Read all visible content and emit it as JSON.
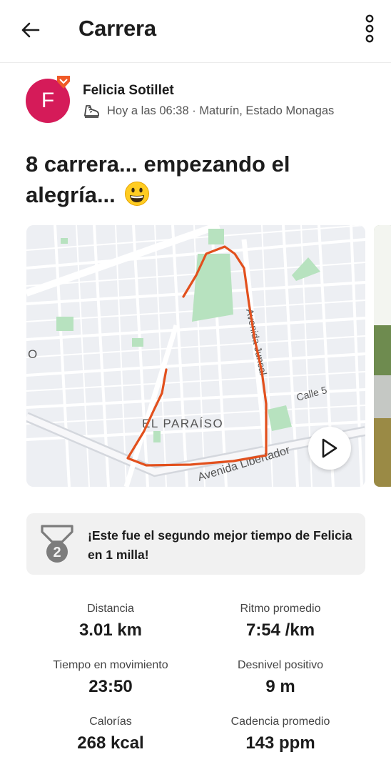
{
  "header": {
    "title": "Carrera",
    "back_icon": "arrow-left-icon",
    "more_icon": "more-vertical-icon"
  },
  "author": {
    "initial": "F",
    "name": "Felicia Sotillet",
    "meta": "Hoy a las 06:38 · Maturín, Estado Monagas",
    "avatar_color": "#d51b59",
    "badge_color": "#f05a28",
    "activity_icon": "shoe-icon"
  },
  "activity": {
    "title": "8 carrera... empezando el alegría...",
    "emoji": "grinning-face-emoji"
  },
  "map": {
    "labels": {
      "street_main": "Avenida Libertador",
      "street_side": "Avenida Juncal",
      "street_small": "Calle 5",
      "neighborhood": "EL PARAÍSO"
    },
    "route_color": "#e2501d",
    "play_icon": "play-icon"
  },
  "achievement": {
    "text": "¡Este fue el segundo mejor tiempo de Felicia en 1 milla!",
    "medal_number": "2",
    "medal_icon": "medal-icon"
  },
  "stats": [
    {
      "label": "Distancia",
      "value": "3.01 km"
    },
    {
      "label": "Ritmo promedio",
      "value": "7:54 /km"
    },
    {
      "label": "Tiempo en movimiento",
      "value": "23:50"
    },
    {
      "label": "Desnivel positivo",
      "value": "9 m"
    },
    {
      "label": "Calorías",
      "value": "268 kcal"
    },
    {
      "label": "Cadencia promedio",
      "value": "143 ppm"
    }
  ]
}
